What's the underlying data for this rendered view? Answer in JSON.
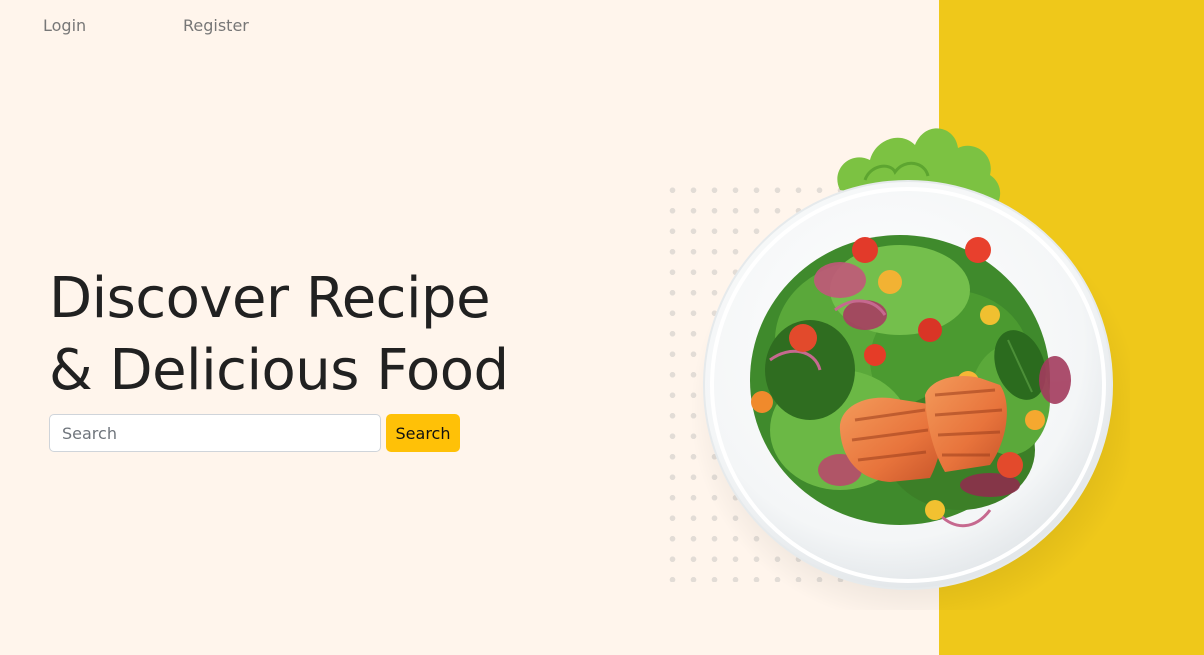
{
  "nav": {
    "login_label": "Login",
    "register_label": "Register"
  },
  "hero": {
    "title_line1": "Discover Recipe",
    "title_line2": "& Delicious Food"
  },
  "search": {
    "placeholder": "Search",
    "value": "",
    "button_label": "Search"
  },
  "colors": {
    "page_background": "#fff5ec",
    "accent_panel": "#efc81a",
    "search_button": "#ffc107",
    "title_text": "#212121"
  },
  "images": {
    "hero_dish": "salad-with-grilled-salmon-plate"
  }
}
